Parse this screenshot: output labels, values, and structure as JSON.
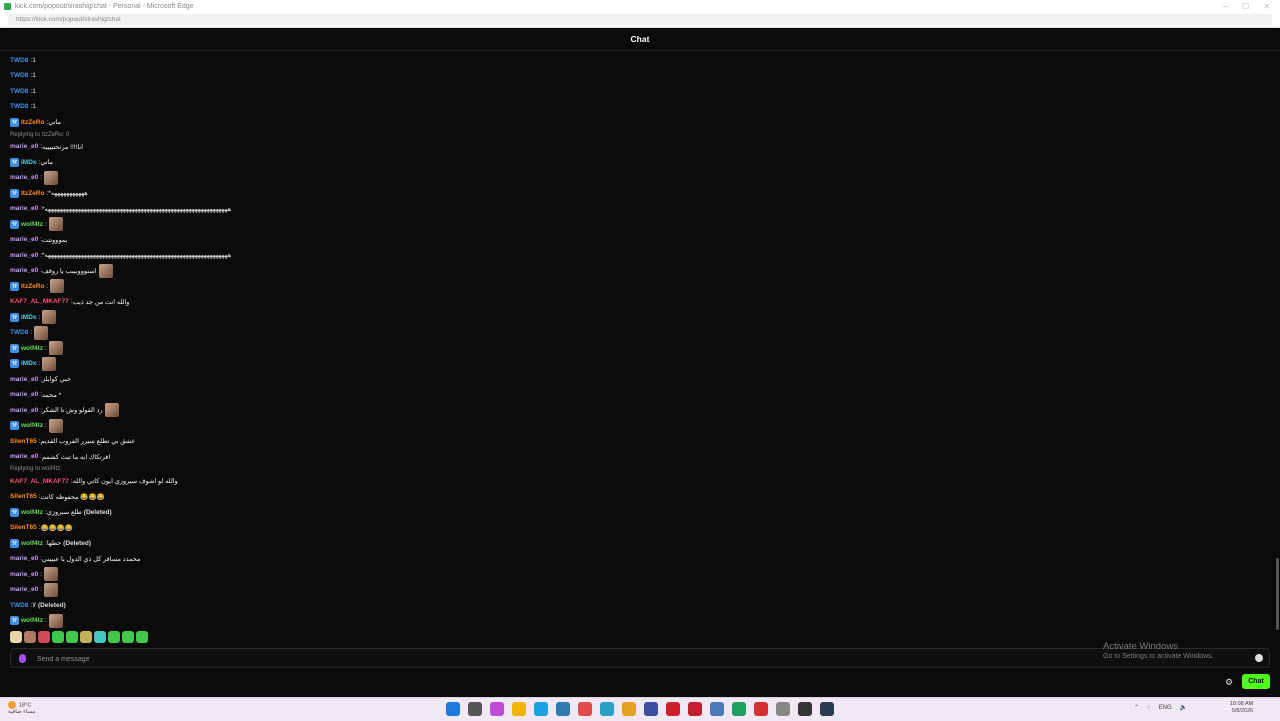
{
  "window": {
    "title": "kick.com/popout/sirashig/chat - Personal - Microsoft Edge",
    "url": "https://kick.com/popout/sirashig/chat",
    "controls": [
      "─",
      "☐",
      "✕"
    ]
  },
  "chat": {
    "header": "Chat",
    "messages": [
      {
        "user": "TWD8",
        "color": "#3b8eea",
        "badge": false,
        "text": "1",
        "emote": false,
        "deleted": false
      },
      {
        "user": "TWD8",
        "color": "#3b8eea",
        "badge": false,
        "text": "1",
        "emote": false,
        "deleted": false
      },
      {
        "user": "TWD8",
        "color": "#3b8eea",
        "badge": false,
        "text": "1",
        "emote": false,
        "deleted": false
      },
      {
        "user": "TWD8",
        "color": "#3b8eea",
        "badge": false,
        "text": "1",
        "emote": false,
        "deleted": false
      },
      {
        "user": "ItzZeRo",
        "color": "#ff8a1f",
        "badge": true,
        "text": "ماتي",
        "emote": false,
        "deleted": false
      },
      {
        "user": "marie_e0",
        "color": "#c69cf5",
        "badge": false,
        "text": "انا!!!! مرتحتييييه",
        "emote": false,
        "deleted": false,
        "reply": "Replying to ItzZeRo: 0"
      },
      {
        "user": "iMDx",
        "color": "#4fd1e6",
        "badge": true,
        "text": "ماتي",
        "emote": false,
        "deleted": false
      },
      {
        "user": "marie_e0",
        "color": "#c69cf5",
        "badge": false,
        "text": "",
        "emote": true,
        "deleted": false
      },
      {
        "user": "ItzZeRo",
        "color": "#ff8a1f",
        "badge": true,
        "text": "*هههههههههههه",
        "emote": false,
        "deleted": false
      },
      {
        "user": "marie_e0",
        "color": "#c69cf5",
        "badge": false,
        "text": "*هههههههههههههههههههههههههههههههههههههههههههههههههههههههههههههه",
        "emote": false,
        "deleted": false
      },
      {
        "user": "wolf4tz",
        "color": "#67e05a",
        "badge": true,
        "text": "",
        "emote": true,
        "deleted": false
      },
      {
        "user": "marie_e0",
        "color": "#c69cf5",
        "badge": false,
        "text": "بموووتتت",
        "emote": false,
        "deleted": false
      },
      {
        "user": "marie_e0",
        "color": "#c69cf5",
        "badge": false,
        "text": "*هههههههههههههههههههههههههههههههههههههههههههههههههههههههههههههه",
        "emote": false,
        "deleted": false
      },
      {
        "user": "marie_e0",
        "color": "#c69cf5",
        "badge": false,
        "text": "استوووبببب يا روقف",
        "emote": true,
        "deleted": false
      },
      {
        "user": "ItzZeRo",
        "color": "#ff8a1f",
        "badge": true,
        "text": "",
        "emote": true,
        "deleted": false
      },
      {
        "user": "KAF7_AL_MKAF77",
        "color": "#ff4d6d",
        "badge": false,
        "text": "والله انت من جد ذيب",
        "emote": false,
        "deleted": false
      },
      {
        "user": "iMDx",
        "color": "#4fd1e6",
        "badge": true,
        "text": "",
        "emote": true,
        "deleted": false
      },
      {
        "user": "TWD8",
        "color": "#3b8eea",
        "badge": false,
        "text": "",
        "emote": true,
        "deleted": false
      },
      {
        "user": "wolf4tz",
        "color": "#67e05a",
        "badge": true,
        "text": "",
        "emote": true,
        "deleted": false
      },
      {
        "user": "iMDx",
        "color": "#4fd1e6",
        "badge": true,
        "text": "",
        "emote": true,
        "deleted": false
      },
      {
        "user": "marie_e0",
        "color": "#c69cf5",
        "badge": false,
        "text": "حبي كوابلز",
        "emote": false,
        "deleted": false
      },
      {
        "user": "marie_e0",
        "color": "#c69cf5",
        "badge": false,
        "text": "محمد *",
        "emote": false,
        "deleted": false
      },
      {
        "user": "marie_e0",
        "color": "#c69cf5",
        "badge": false,
        "text": "رد القولو وش تا الشكر",
        "emote": true,
        "deleted": false
      },
      {
        "user": "wolf4tz",
        "color": "#67e05a",
        "badge": true,
        "text": "",
        "emote": true,
        "deleted": false
      },
      {
        "user": "SilenT65",
        "color": "#ff8a1f",
        "badge": false,
        "text": "عشق بي تطلع سيرر الفروب القديم",
        "emote": false,
        "deleted": false
      },
      {
        "user": "marie_e0",
        "color": "#c69cf5",
        "badge": false,
        "text": "افرتكاك ايه ما تبث كشمم",
        "emote": false,
        "deleted": false
      },
      {
        "user": "KAF7_AL_MKAF77",
        "color": "#ff4d6d",
        "badge": false,
        "text": "والله لو اشوف سيروزي ايون كاتي والله",
        "emote": false,
        "deleted": false,
        "reply": "Replying to wolf4tz:"
      },
      {
        "user": "SilenT65",
        "color": "#ff8a1f",
        "badge": false,
        "text": "محفوظه كانت 😂😂😂",
        "emote": false,
        "deleted": false
      },
      {
        "user": "wolf4tz",
        "color": "#67e05a",
        "badge": true,
        "text": "طلع سيروزي",
        "emote": false,
        "deleted": true
      },
      {
        "user": "SilenT65",
        "color": "#ff8a1f",
        "badge": false,
        "text": "😂😂😂😂",
        "emote": false,
        "deleted": false
      },
      {
        "user": "wolf4tz",
        "color": "#67e05a",
        "badge": true,
        "text": "حطها",
        "emote": false,
        "deleted": true
      },
      {
        "user": "marie_e0",
        "color": "#c69cf5",
        "badge": false,
        "text": "محمدد مسافر كل ذي الدول يا عيييني",
        "emote": false,
        "deleted": false
      },
      {
        "user": "marie_e0",
        "color": "#c69cf5",
        "badge": false,
        "text": "",
        "emote": true,
        "deleted": false
      },
      {
        "user": "marie_e0",
        "color": "#c69cf5",
        "badge": false,
        "text": "",
        "emote": true,
        "deleted": false
      },
      {
        "user": "TWD8",
        "color": "#3b8eea",
        "badge": false,
        "text": "لا",
        "emote": false,
        "deleted": true
      },
      {
        "user": "wolf4tz",
        "color": "#67e05a",
        "badge": true,
        "text": "",
        "emote": true,
        "deleted": false
      }
    ],
    "deleted_label": "(Deleted)",
    "input_placeholder": "Send a message",
    "send_label": "Chat",
    "emote_colors": [
      "#e8d6a4",
      "#b07a63",
      "#d04a5a",
      "#42c94a",
      "#42c94a",
      "#c2b35a",
      "#41c7c0",
      "#42c94a",
      "#42c94a",
      "#42c94a"
    ]
  },
  "watermark": {
    "line1": "Activate Windows",
    "line2": "Go to Settings to activate Windows."
  },
  "taskbar": {
    "weather_temp": "18°C",
    "weather_desc": "مساء صافية",
    "lang": "ENG",
    "time": "10:08 AM",
    "date": "5/8/2026",
    "icon_colors": [
      "#1f7ae0",
      "#555555",
      "#c04ad8",
      "#f0b400",
      "#1aa1e2",
      "#2f7ab0",
      "#e04a4a",
      "#29a0c8",
      "#e8a020",
      "#3c4fa0",
      "#d02030",
      "#c02030",
      "#4a7ab8",
      "#20a060",
      "#d83030",
      "#888888",
      "#333333",
      "#2a3a50"
    ]
  },
  "accent": "#53fc18"
}
